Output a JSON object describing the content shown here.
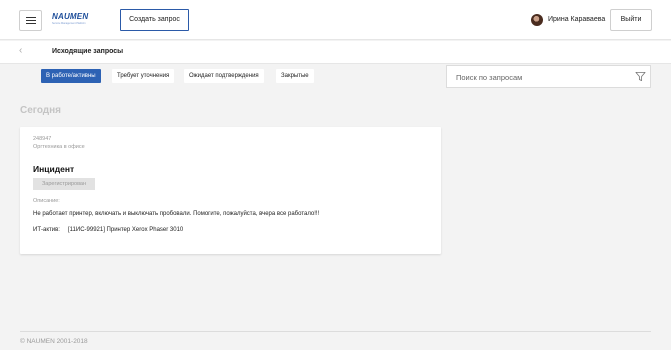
{
  "header": {
    "logo_text": "NAUMEN",
    "logo_tagline": "Service Management Platform",
    "create_button": "Создать запрос",
    "user_name": "Ирина Караваева",
    "logout_button": "Выйти",
    "menu_icon": "hamburger-icon",
    "avatar_icon": "user-avatar"
  },
  "subheader": {
    "back_icon": "chevron-left-icon",
    "back_glyph": "‹",
    "title": "Исходящие запросы"
  },
  "filters": {
    "tabs": [
      {
        "label": "В работе/активны",
        "active": true
      },
      {
        "label": "Требует уточнения",
        "active": false
      },
      {
        "label": "Ожидает подтверждения",
        "active": false
      },
      {
        "label": "Закрытые",
        "active": false
      }
    ],
    "search_placeholder": "Поиск по запросам",
    "filter_icon": "filter-icon"
  },
  "section": {
    "title": "Сегодня"
  },
  "requests": [
    {
      "number": "248947",
      "category": "Оргтехника в офисе",
      "type": "Инцидент",
      "status": "Зарегистрирован",
      "description_label": "Описание:",
      "description": "Не работает принтер, включать и выключать пробовали. Помогите, пожалуйста, вчера все работало!!!",
      "asset_label": "ИТ-актив:",
      "asset_value": "[11ИС-99921] Принтер Xerox Phaser 3010"
    }
  ],
  "footer": {
    "copyright": "© NAUMEN 2001-2018"
  },
  "colors": {
    "accent": "#2d62b4",
    "logo": "#1e4e9a",
    "background": "#f3f3f3",
    "muted_text": "#999999",
    "status_bg": "#e2e2e2"
  }
}
